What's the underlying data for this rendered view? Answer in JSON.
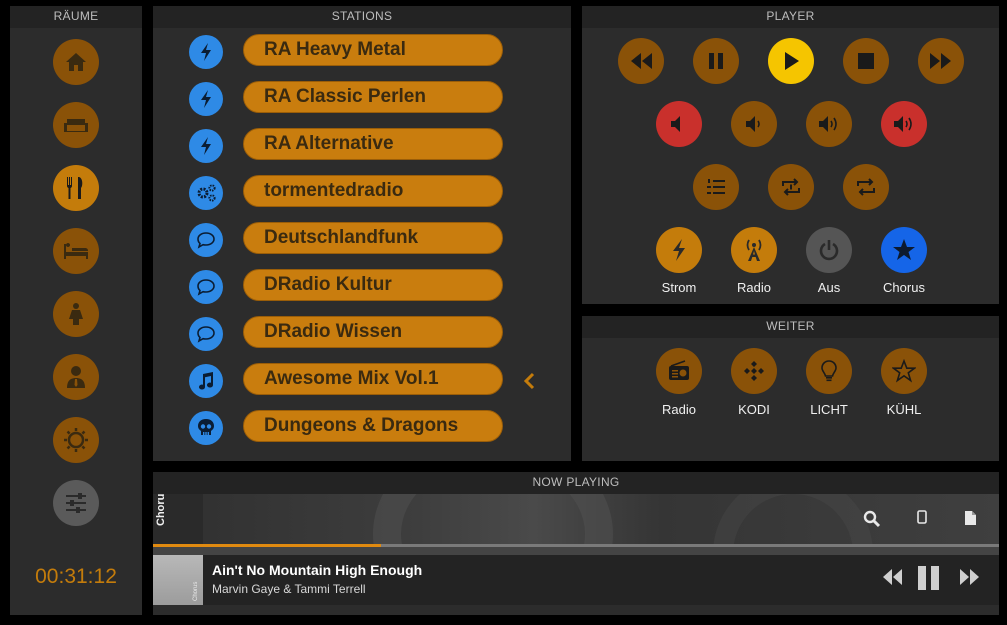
{
  "rooms": {
    "title": "RÄUME",
    "items": [
      {
        "icon": "home-icon"
      },
      {
        "icon": "sofa-icon"
      },
      {
        "icon": "fork-knife-icon"
      },
      {
        "icon": "bed-icon"
      },
      {
        "icon": "woman-icon"
      },
      {
        "icon": "man-suit-icon"
      },
      {
        "icon": "sun-icon"
      },
      {
        "icon": "sliders-icon"
      }
    ],
    "clock": "00:31:12"
  },
  "stations": {
    "title": "STATIONS",
    "items": [
      {
        "label": "RA Heavy Metal",
        "icon": "lightning-icon"
      },
      {
        "label": "RA Classic Perlen",
        "icon": "lightning-icon"
      },
      {
        "label": "RA Alternative",
        "icon": "lightning-icon"
      },
      {
        "label": "tormentedradio",
        "icon": "gears-icon"
      },
      {
        "label": "Deutschlandfunk",
        "icon": "speech-bubble-icon"
      },
      {
        "label": "DRadio Kultur",
        "icon": "speech-bubble-icon"
      },
      {
        "label": "DRadio Wissen",
        "icon": "speech-bubble-icon"
      },
      {
        "label": "Awesome Mix Vol.1",
        "icon": "music-note-icon",
        "selected": true
      },
      {
        "label": "Dungeons & Dragons",
        "icon": "skull-icon"
      }
    ]
  },
  "player": {
    "title": "PLAYER",
    "sources": [
      {
        "label": "Strom",
        "icon": "lightning-icon"
      },
      {
        "label": "Radio",
        "icon": "antenna-icon"
      },
      {
        "label": "Aus",
        "icon": "power-icon"
      },
      {
        "label": "Chorus",
        "icon": "star-icon"
      }
    ]
  },
  "weiter": {
    "title": "WEITER",
    "items": [
      {
        "label": "Radio",
        "icon": "radio-icon"
      },
      {
        "label": "KODI",
        "icon": "kodi-icon"
      },
      {
        "label": "LICHT",
        "icon": "lightbulb-icon"
      },
      {
        "label": "KÜHL",
        "icon": "star-outline-icon"
      }
    ]
  },
  "now_playing": {
    "title": "NOW PLAYING",
    "tab_label": "Chorus.",
    "track_title": "Ain't No Mountain High Enough",
    "artist": "Marvin Gaye & Tammi Terrell",
    "thumb_text": "Chorus",
    "progress": 0.27
  },
  "colors": {
    "accent_orange": "#c47c0b",
    "dim_orange": "#8a5208",
    "play_yellow": "#f5c500",
    "mute_red": "#c9302c",
    "station_blue": "#2e8ae6",
    "chorus_blue": "#1565e8"
  }
}
